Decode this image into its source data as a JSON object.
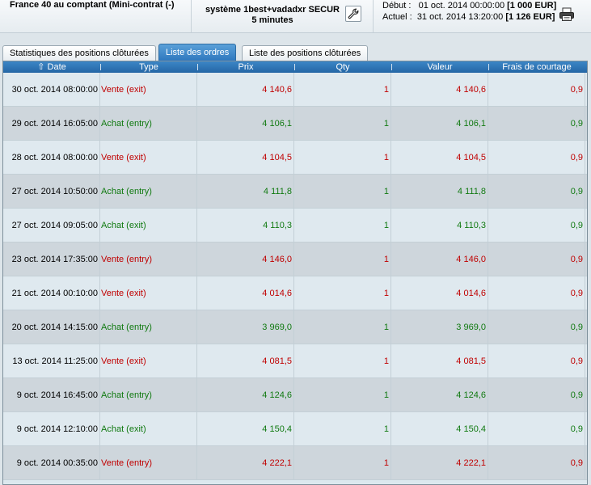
{
  "header": {
    "instrument": "France 40 au comptant (Mini-contrat  (-)",
    "system_line1": "système 1best+vadadxr SECUR",
    "system_line2": "5 minutes",
    "start_label": "Début :",
    "start_date": "01 oct. 2014 00:00:00",
    "start_value": "[1 000 EUR]",
    "current_label": "Actuel :",
    "current_date": "31 oct. 2014 13:20:00",
    "current_value": "[1 126 EUR]",
    "settings_icon": "wrench-icon",
    "print_icon": "printer-icon"
  },
  "tabs": [
    {
      "label": "Statistiques des positions clôturées",
      "active": false
    },
    {
      "label": "Liste des ordres",
      "active": true
    },
    {
      "label": "Liste des positions clôturées",
      "active": false
    }
  ],
  "table": {
    "columns": [
      "Date",
      "Type",
      "Prix",
      "Qty",
      "Valeur",
      "Frais de courtage"
    ],
    "sort_column": "Date",
    "colors": {
      "sell": "#c00000",
      "buy": "#117a11"
    },
    "rows": [
      {
        "date": "30 oct. 2014 08:00:00",
        "type": "Vente (exit)",
        "prix": "4 140,6",
        "qty": "1",
        "valeur": "4 140,6",
        "frais": "0,9",
        "side": "sell"
      },
      {
        "date": "29 oct. 2014 16:05:00",
        "type": "Achat (entry)",
        "prix": "4 106,1",
        "qty": "1",
        "valeur": "4 106,1",
        "frais": "0,9",
        "side": "buy"
      },
      {
        "date": "28 oct. 2014 08:00:00",
        "type": "Vente (exit)",
        "prix": "4 104,5",
        "qty": "1",
        "valeur": "4 104,5",
        "frais": "0,9",
        "side": "sell"
      },
      {
        "date": "27 oct. 2014 10:50:00",
        "type": "Achat (entry)",
        "prix": "4 111,8",
        "qty": "1",
        "valeur": "4 111,8",
        "frais": "0,9",
        "side": "buy"
      },
      {
        "date": "27 oct. 2014 09:05:00",
        "type": "Achat (exit)",
        "prix": "4 110,3",
        "qty": "1",
        "valeur": "4 110,3",
        "frais": "0,9",
        "side": "buy"
      },
      {
        "date": "23 oct. 2014 17:35:00",
        "type": "Vente (entry)",
        "prix": "4 146,0",
        "qty": "1",
        "valeur": "4 146,0",
        "frais": "0,9",
        "side": "sell"
      },
      {
        "date": "21 oct. 2014 00:10:00",
        "type": "Vente (exit)",
        "prix": "4 014,6",
        "qty": "1",
        "valeur": "4 014,6",
        "frais": "0,9",
        "side": "sell"
      },
      {
        "date": "20 oct. 2014 14:15:00",
        "type": "Achat (entry)",
        "prix": "3 969,0",
        "qty": "1",
        "valeur": "3 969,0",
        "frais": "0,9",
        "side": "buy"
      },
      {
        "date": "13 oct. 2014 11:25:00",
        "type": "Vente (exit)",
        "prix": "4 081,5",
        "qty": "1",
        "valeur": "4 081,5",
        "frais": "0,9",
        "side": "sell"
      },
      {
        "date": "9 oct. 2014 16:45:00",
        "type": "Achat (entry)",
        "prix": "4 124,6",
        "qty": "1",
        "valeur": "4 124,6",
        "frais": "0,9",
        "side": "buy"
      },
      {
        "date": "9 oct. 2014 12:10:00",
        "type": "Achat (exit)",
        "prix": "4 150,4",
        "qty": "1",
        "valeur": "4 150,4",
        "frais": "0,9",
        "side": "buy"
      },
      {
        "date": "9 oct. 2014 00:35:00",
        "type": "Vente (entry)",
        "prix": "4 222,1",
        "qty": "1",
        "valeur": "4 222,1",
        "frais": "0,9",
        "side": "sell"
      }
    ]
  }
}
